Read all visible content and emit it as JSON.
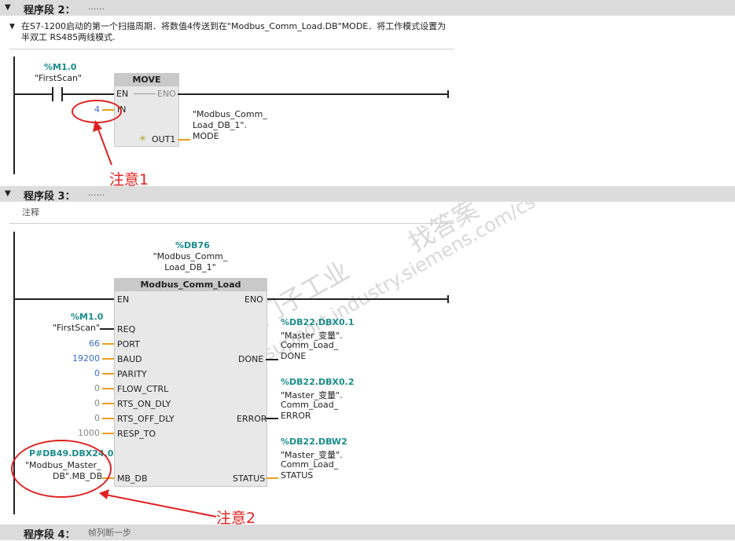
{
  "segment2": {
    "label": "程序段 2：",
    "dots": "......",
    "comment": "在S7-1200启动的第一个扫描周期．将数值4传送到在\"Modbus_Comm_Load.DB\"MODE．将工作模式设置为半双工 RS485两线模式."
  },
  "segment3": {
    "label": "程序段 3：",
    "dots": "......",
    "comment": "注释"
  },
  "segment4": {
    "label": "程序段 4：",
    "dots": "......",
    "comment": "帧列断一步"
  },
  "contact": {
    "addr": "%M1.0",
    "name": "\"FirstScan\""
  },
  "move": {
    "title": "MOVE",
    "en": "EN",
    "eno": "ENO",
    "in": "IN",
    "in_val": "4",
    "out": "OUT1",
    "out_var": "\"Modbus_Comm_ Load_DB_1\". MODE"
  },
  "instance": {
    "addr": "%DB76",
    "name": "\"Modbus_Comm_ Load_DB_1\""
  },
  "comm_load": {
    "title": "Modbus_Comm_Load",
    "en": "EN",
    "eno": "ENO",
    "inputs": [
      {
        "pin": "REQ",
        "val": "\"FirstScan\"",
        "addr": "%M1.0"
      },
      {
        "pin": "PORT",
        "val": "66"
      },
      {
        "pin": "BAUD",
        "val": "19200"
      },
      {
        "pin": "PARITY",
        "val": "0"
      },
      {
        "pin": "FLOW_CTRL",
        "val": "0"
      },
      {
        "pin": "RTS_ON_DLY",
        "val": "0"
      },
      {
        "pin": "RTS_OFF_DLY",
        "val": "0"
      },
      {
        "pin": "RESP_TO",
        "val": "1000"
      },
      {
        "pin": "MB_DB",
        "addr": "P#DB49.DBX24.0",
        "val1": "\"Modbus_Master_",
        "val2": "DB\".MB_DB"
      }
    ],
    "outputs": [
      {
        "pin": "DONE",
        "addr": "%DB22.DBX0.1",
        "l1": "\"Master_变量\".",
        "l2": "Comm_Load_",
        "l3": "DONE"
      },
      {
        "pin": "ERROR",
        "addr": "%DB22.DBX0.2",
        "l1": "\"Master_变量\".",
        "l2": "Comm_Load_",
        "l3": "ERROR"
      },
      {
        "pin": "STATUS",
        "addr": "%DB22.DBW2",
        "l1": "\"Master_变量\".",
        "l2": "Comm_Load_",
        "l3": "STATUS"
      }
    ]
  },
  "annotations": {
    "note1": "注意1",
    "note2": "注意2"
  },
  "watermark": {
    "text1": "西门子工业",
    "text2": "support.industry.siemens.com/cs",
    "text3": "找答案"
  },
  "colors": {
    "accent_red": "#e02020",
    "teal": "#1b8c8c",
    "blue": "#3b6ed0",
    "orange": "#e8a020"
  }
}
